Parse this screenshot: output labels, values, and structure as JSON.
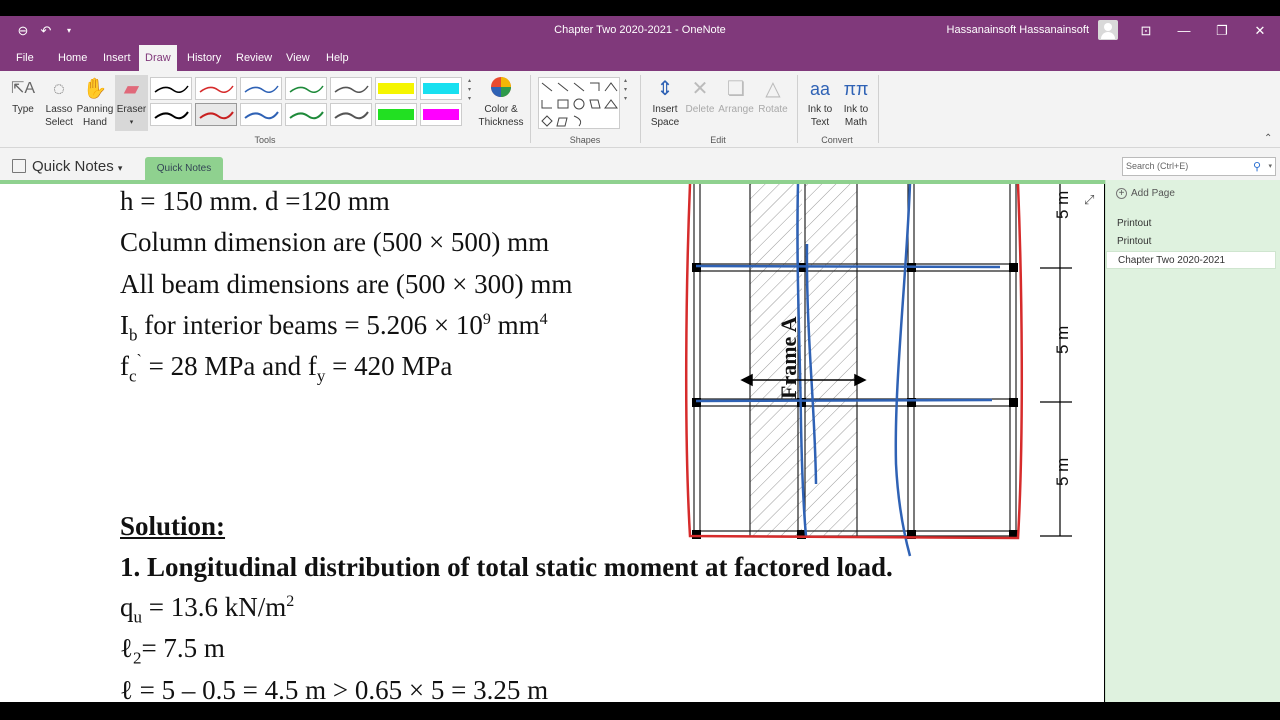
{
  "window": {
    "title": "Chapter Two 2020-2021  -  OneNote",
    "user": "Hassanainsoft Hassanainsoft"
  },
  "menu": {
    "items": [
      "File",
      "Home",
      "Insert",
      "Draw",
      "History",
      "Review",
      "View",
      "Help"
    ],
    "active": "Draw"
  },
  "ribbon": {
    "type": "Type",
    "lasso": [
      "Lasso",
      "Select"
    ],
    "panning": [
      "Panning",
      "Hand"
    ],
    "eraser": "Eraser",
    "color_thickness": [
      "Color &",
      "Thickness"
    ],
    "insert_space": [
      "Insert",
      "Space"
    ],
    "delete": "Delete",
    "arrange": "Arrange",
    "rotate": "Rotate",
    "ink_to_text": [
      "Ink to",
      "Text"
    ],
    "ink_to_math": [
      "Ink to",
      "Math"
    ],
    "groups": {
      "tools": "Tools",
      "shapes": "Shapes",
      "edit": "Edit",
      "convert": "Convert"
    },
    "pen_colors": [
      "#000000",
      "#d62b2b",
      "#2f62b5",
      "#1e8a3a",
      "#555555",
      "#f5f500",
      "#18e0f0",
      "#000000",
      "#c82020",
      "#2f62b5",
      "#1e8a3a",
      "#555555",
      "#22e022",
      "#ff00ff"
    ]
  },
  "nav": {
    "notebook": "Quick Notes",
    "section": "Quick Notes",
    "search_placeholder": "Search (Ctrl+E)"
  },
  "pages": {
    "add": "Add Page",
    "items": [
      "Printout",
      "Printout",
      "Chapter Two 2020-2021"
    ]
  },
  "content": {
    "l1": "h = 150 mm. d =120 mm",
    "l2": "Column dimension are (500 × 500) mm",
    "l3": "All beam dimensions are (500 × 300) mm",
    "l4a": "I",
    "l4sub": "b",
    "l4b": " for interior beams = 5.206 × 10",
    "l4sup": "9",
    "l4c": " mm",
    "l4sup2": "4",
    "l5a": "f",
    "l5sub": "c",
    "l5sup": "`",
    "l5b": " = 28 MPa and f",
    "l5sub2": "y",
    "l5c": " = 420 MPa",
    "solution": "Solution:",
    "step1": "1.  Longitudinal distribution of total static moment at factored load.",
    "qu_a": "q",
    "qu_sub": "u",
    "qu_b": " = 13.6 kN/m",
    "qu_sup": "2",
    "l2_a": "ℓ",
    "l2_sub": "2",
    "l2_b": "= 7.5 m",
    "partial": "ℓ  = 5 – 0.5 = 4.5 m > 0.65 × 5 = 3.25 m"
  },
  "figure": {
    "frame_label": "Frame A",
    "dims": [
      "5 m",
      "5 m",
      "5 m"
    ]
  }
}
